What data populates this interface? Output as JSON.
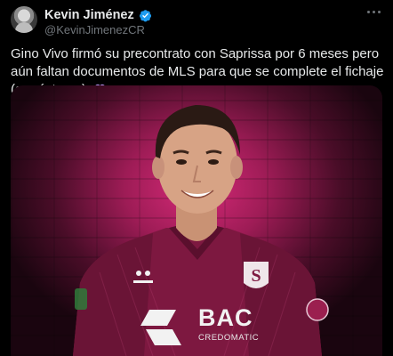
{
  "author": {
    "name": "Kevin Jiménez",
    "handle": "@KevinJimenezCR"
  },
  "tweet": {
    "text": "Gino Vivo firmó su precontrato con Saprissa por 6 meses pero aún faltan documentos de MLS para que se complete el fichaje (a préstamo)."
  },
  "media": {
    "sponsor_name": "BAC",
    "sponsor_sub": "CREDOMATIC",
    "crest_letter": "S"
  },
  "icons": {
    "verified": "verified-badge-icon",
    "heart": "purple-heart-emoji",
    "more": "more-options-icon"
  },
  "colors": {
    "background": "#000000",
    "verified": "#1d9bf0",
    "heart": "#a98ae0",
    "jersey": "#8a1a44"
  }
}
